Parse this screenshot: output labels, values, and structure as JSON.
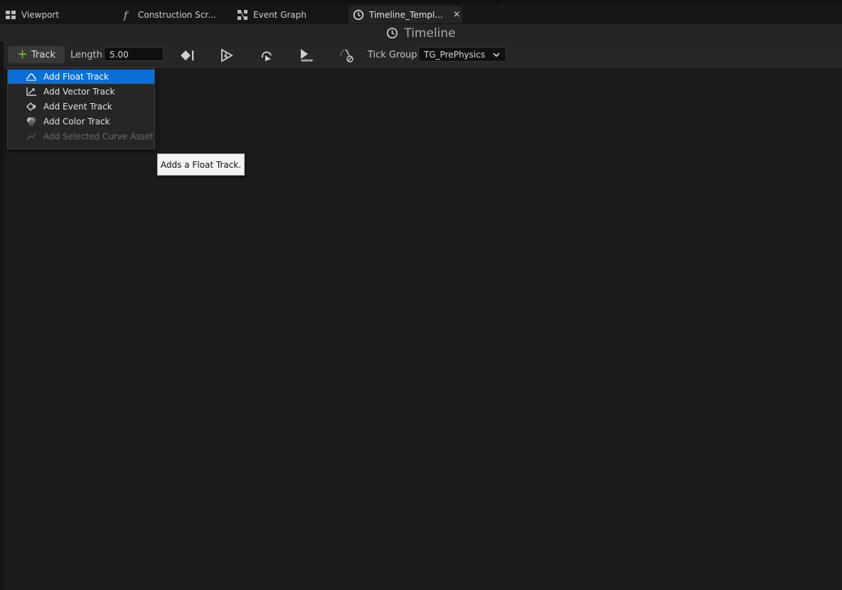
{
  "tabs": [
    {
      "label": "Viewport",
      "icon": "viewport-icon"
    },
    {
      "label": "Construction Scr...",
      "icon": "function-icon"
    },
    {
      "label": "Event Graph",
      "icon": "event-graph-icon"
    },
    {
      "label": "Timeline_Templ...",
      "icon": "clock-icon",
      "active": true,
      "close": "×"
    }
  ],
  "title": "Timeline",
  "toolbar": {
    "track_label": "Track",
    "length_label": "Length",
    "length_value": "5.00",
    "tick_group_label": "Tick Group",
    "tick_group_value": "TG_PrePhysics"
  },
  "menu": {
    "items": [
      {
        "label": "Add Float Track",
        "icon": "float-track-icon",
        "selected": true
      },
      {
        "label": "Add Vector Track",
        "icon": "vector-track-icon"
      },
      {
        "label": "Add Event Track",
        "icon": "event-track-icon"
      },
      {
        "label": "Add Color Track",
        "icon": "color-track-icon"
      },
      {
        "label": "Add Selected Curve Asset",
        "icon": "curve-asset-icon",
        "disabled": true
      }
    ]
  },
  "tooltip": "Adds a Float Track.",
  "colors": {
    "accent": "#0a6fd6",
    "plus": "#7ec048",
    "background": "#1b1b1b"
  }
}
